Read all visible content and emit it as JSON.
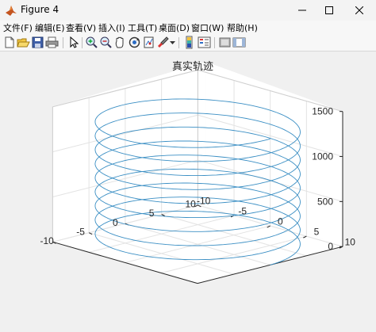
{
  "window": {
    "title": "Figure 4"
  },
  "menu": [
    "文件(F)",
    "编辑(E)",
    "查看(V)",
    "插入(I)",
    "工具(T)",
    "桌面(D)",
    "窗口(W)",
    "帮助(H)"
  ],
  "toolbar": {
    "buttons": [
      "new-figure-icon",
      "open-file-icon",
      "save-icon",
      "print-icon",
      "pointer-icon",
      "zoom-in-icon",
      "zoom-out-icon",
      "pan-icon",
      "rotate-3d-icon",
      "data-cursor-icon",
      "brush-icon",
      "dropdown-arrow-icon",
      "colorbar-icon",
      "legend-icon",
      "hide-plot-tools-icon",
      "show-plot-tools-icon"
    ]
  },
  "chart_data": {
    "type": "line3d",
    "title": "真实轨迹",
    "series": [
      {
        "kind": "helix",
        "center": [
          0,
          0
        ],
        "radius": 10,
        "turns": 9,
        "z_start": 0,
        "z_end": 1400,
        "color": "#3b8fc4"
      }
    ],
    "xlim": [
      -10,
      10
    ],
    "ylim": [
      -10,
      10
    ],
    "zlim": [
      0,
      1500
    ],
    "x_ticks": [
      "-10",
      "-5",
      "0",
      "5",
      "10"
    ],
    "y_ticks": [
      "-10",
      "-5",
      "0",
      "5",
      "10"
    ],
    "z_ticks": [
      "0",
      "500",
      "1000",
      "1500"
    ],
    "grid": true
  }
}
